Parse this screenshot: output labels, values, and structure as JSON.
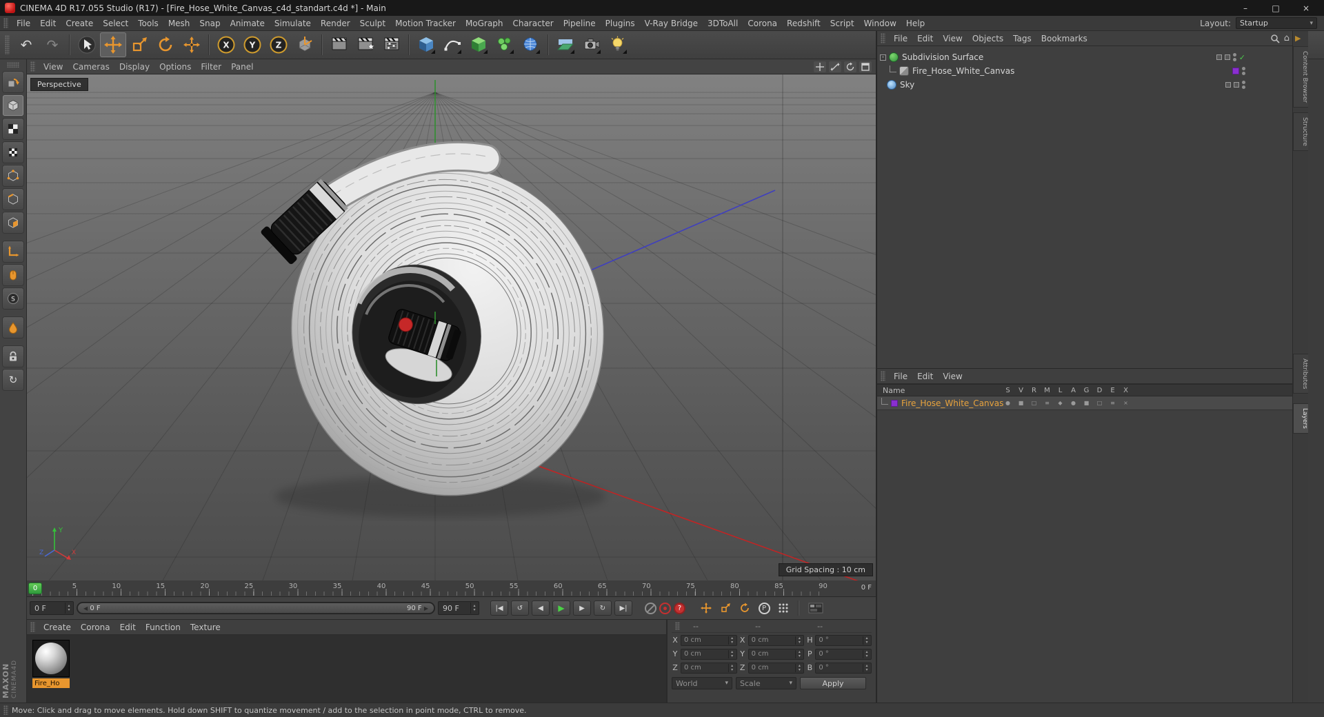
{
  "glyphs": {
    "up": "▴",
    "down": "▾",
    "left": "◀",
    "right": "▶",
    "minus": "-",
    "check": "✓",
    "home": "⌂",
    "close": "×",
    "restore": "□",
    "minimize": "–"
  },
  "titlebar": {
    "title": "CINEMA 4D R17.055 Studio (R17) - [Fire_Hose_White_Canvas_c4d_standart.c4d *] - Main"
  },
  "menubar": {
    "items": [
      "File",
      "Edit",
      "Create",
      "Select",
      "Tools",
      "Mesh",
      "Snap",
      "Animate",
      "Simulate",
      "Render",
      "Sculpt",
      "Motion Tracker",
      "MoGraph",
      "Character",
      "Pipeline",
      "Plugins",
      "V-Ray Bridge",
      "3DToAll",
      "Corona",
      "Redshift",
      "Script",
      "Window",
      "Help"
    ],
    "layout_label": "Layout:",
    "layout_value": "Startup"
  },
  "toolbar": {
    "axis_x": "X",
    "axis_y": "Y",
    "axis_z": "Z",
    "snap_s": "S",
    "undo": "↶",
    "redo": "↷",
    "rotate": "↻"
  },
  "viewport": {
    "menus": [
      "View",
      "Cameras",
      "Display",
      "Options",
      "Filter",
      "Panel"
    ],
    "camera_label": "Perspective",
    "grid_label": "Grid Spacing : 10 cm",
    "axis": {
      "x": "X",
      "y": "Y",
      "z": "Z"
    }
  },
  "object_manager": {
    "menus": [
      "File",
      "Edit",
      "View",
      "Objects",
      "Tags",
      "Bookmarks"
    ],
    "objects": [
      "Subdivision Surface",
      "Fire_Hose_White_Canvas",
      "Sky"
    ]
  },
  "layer_manager": {
    "menus": [
      "File",
      "Edit",
      "View"
    ],
    "name_header": "Name",
    "columns": [
      "S",
      "V",
      "R",
      "M",
      "L",
      "A",
      "G",
      "D",
      "E",
      "X"
    ],
    "layer_name": "Fire_Hose_White_Canvas",
    "flag_glyphs": [
      "●",
      "■",
      "□",
      "≡",
      "◆",
      "●",
      "■",
      "□",
      "≡",
      "×"
    ]
  },
  "timeline": {
    "ticks": [
      "0",
      "5",
      "10",
      "15",
      "20",
      "25",
      "30",
      "35",
      "40",
      "45",
      "50",
      "55",
      "60",
      "65",
      "70",
      "75",
      "80",
      "85",
      "90"
    ],
    "marker": "0",
    "frame_label": "0 F"
  },
  "transport": {
    "start_field": "0 F",
    "slider_start": "0 F",
    "slider_end": "90 F",
    "end_field": "90 F",
    "buttons": [
      "|◀",
      "↺",
      "◀",
      "▶",
      "▶",
      "↻",
      "▶|"
    ],
    "p_label": "P"
  },
  "materials": {
    "menus": [
      "Create",
      "Corona",
      "Edit",
      "Function",
      "Texture"
    ],
    "material_name": "Fire_Ho"
  },
  "coords": {
    "headers": [
      "--",
      "--",
      "--"
    ],
    "pos_labels": [
      "X",
      "Y",
      "Z"
    ],
    "pos_values": [
      "0 cm",
      "0 cm",
      "0 cm"
    ],
    "size_labels": [
      "X",
      "Y",
      "Z"
    ],
    "size_values": [
      "0 cm",
      "0 cm",
      "0 cm"
    ],
    "rot_labels": [
      "H",
      "P",
      "B"
    ],
    "rot_values": [
      "0 °",
      "0 °",
      "0 °"
    ],
    "world": "World",
    "scale": "Scale",
    "apply": "Apply"
  },
  "status": {
    "text": "Move: Click and drag to move elements. Hold down SHIFT to quantize movement / add to the selection in point mode, CTRL to remove."
  },
  "right_tabs": {
    "top": [
      "Content Browser",
      "Structure"
    ],
    "bottom": [
      "Attributes",
      "Layers"
    ]
  },
  "branding": {
    "maxon": "MAXON",
    "cinema": "CINEMA4D"
  }
}
